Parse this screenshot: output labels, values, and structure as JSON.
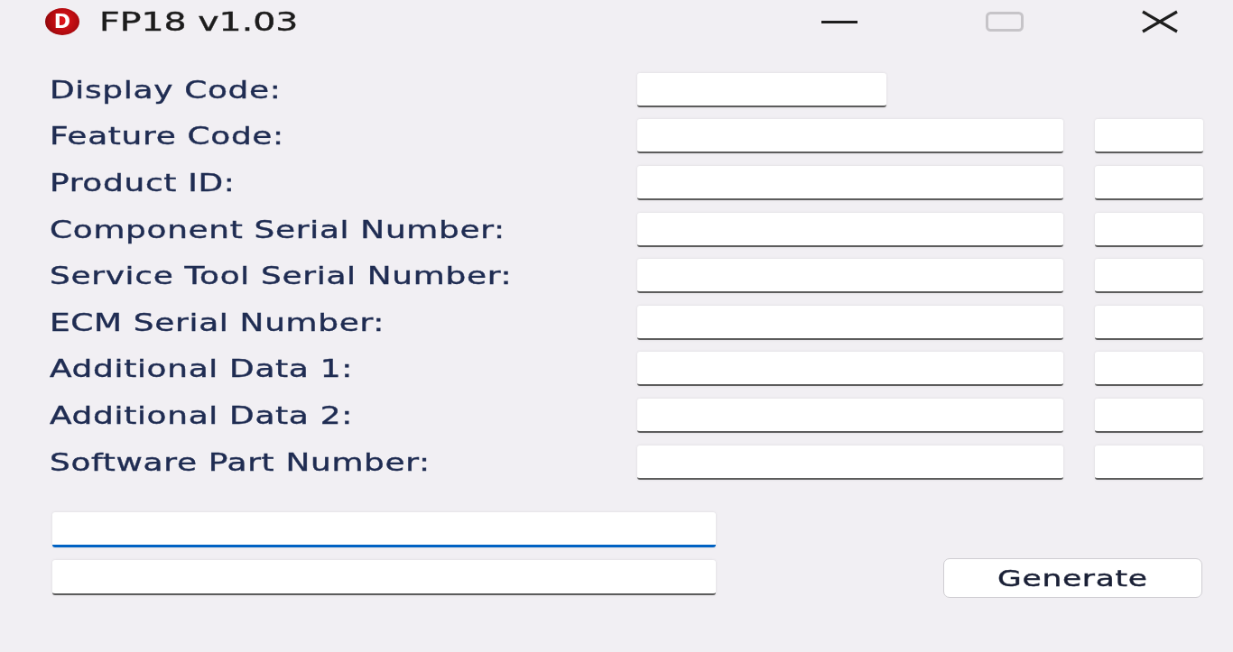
{
  "window": {
    "title": "FP18 v1.03",
    "logo": "D",
    "controls": [
      {
        "kind": "minimize",
        "disabled": false
      },
      {
        "kind": "maximize",
        "disabled": true
      },
      {
        "kind": "close",
        "disabled": false
      }
    ]
  },
  "fields": [
    {
      "label": "Display Code:",
      "kind": "single"
    },
    {
      "label": "Feature Code:",
      "kind": "pair"
    },
    {
      "label": "Product ID:",
      "kind": "pair"
    },
    {
      "label": "Component Serial Number:",
      "kind": "pair"
    },
    {
      "label": "Service Tool Serial Number:",
      "kind": "pair"
    },
    {
      "label": "ECM Serial Number:",
      "kind": "pair"
    },
    {
      "label": "Additional Data 1:",
      "kind": "pair"
    },
    {
      "label": "Additional Data 2:",
      "kind": "pair"
    },
    {
      "label": "Software Part Number:",
      "kind": "pair"
    }
  ],
  "outputs": [
    {
      "focused": true
    },
    {
      "focused": false
    }
  ],
  "generate_button": {
    "label": "Generate"
  }
}
